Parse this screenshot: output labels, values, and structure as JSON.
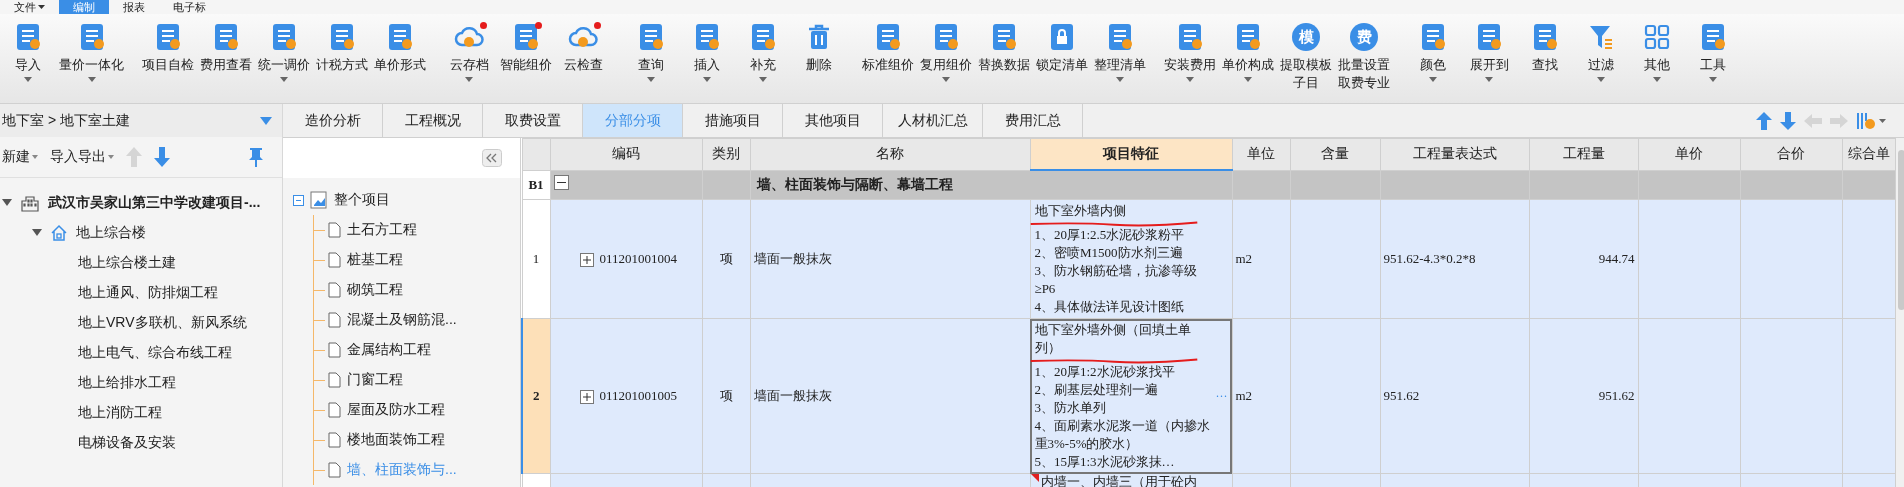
{
  "menu": [
    {
      "label": "文件",
      "dropdown": true,
      "selected": false
    },
    {
      "label": "编制",
      "dropdown": false,
      "selected": true
    },
    {
      "label": "报表",
      "dropdown": false,
      "selected": false
    },
    {
      "label": "电子标",
      "dropdown": false,
      "selected": false
    }
  ],
  "toolbar": {
    "groups": [
      {
        "items": [
          {
            "label": "导入",
            "kind": "icon",
            "dropdown": true,
            "badge": false
          },
          {
            "label": "量价一体化",
            "kind": "icon",
            "dropdown": true,
            "badge": false
          }
        ]
      },
      {
        "items": [
          {
            "label": "项目自检",
            "kind": "icon",
            "dropdown": false,
            "badge": false
          },
          {
            "label": "费用查看",
            "kind": "icon",
            "dropdown": false,
            "badge": false
          },
          {
            "label": "统一调价",
            "kind": "icon",
            "dropdown": true,
            "badge": false
          },
          {
            "label": "计税方式",
            "kind": "icon",
            "dropdown": false,
            "badge": false
          },
          {
            "label": "单价形式",
            "kind": "icon",
            "dropdown": false,
            "badge": false
          }
        ]
      },
      {
        "items": [
          {
            "label": "云存档",
            "kind": "cloud",
            "dropdown": true,
            "badge": true
          },
          {
            "label": "智能组价",
            "kind": "icon",
            "dropdown": false,
            "badge": true
          },
          {
            "label": "云检查",
            "kind": "cloud",
            "dropdown": false,
            "badge": true
          }
        ]
      },
      {
        "items": [
          {
            "label": "查询",
            "kind": "icon",
            "dropdown": true,
            "badge": false
          },
          {
            "label": "插入",
            "kind": "icon",
            "dropdown": true,
            "badge": false
          },
          {
            "label": "补充",
            "kind": "icon",
            "dropdown": true,
            "badge": false
          },
          {
            "label": "删除",
            "kind": "trash",
            "dropdown": false,
            "badge": false
          }
        ]
      },
      {
        "items": [
          {
            "label": "标准组价",
            "kind": "icon",
            "dropdown": false,
            "badge": false
          },
          {
            "label": "复用组价",
            "kind": "icon",
            "dropdown": true,
            "badge": false
          },
          {
            "label": "替换数据",
            "kind": "icon",
            "dropdown": false,
            "badge": false
          },
          {
            "label": "锁定清单",
            "kind": "lock",
            "dropdown": false,
            "badge": false
          },
          {
            "label": "整理清单",
            "kind": "icon",
            "dropdown": true,
            "badge": false
          }
        ]
      },
      {
        "items": [
          {
            "label": "安装费用",
            "kind": "icon",
            "dropdown": true,
            "badge": false
          },
          {
            "label": "单价构成",
            "kind": "icon",
            "dropdown": true,
            "badge": false
          },
          {
            "label": "提取模板",
            "label_2": "子目",
            "kind": "glyph",
            "glyph": "模",
            "dropdown": false,
            "badge": false
          },
          {
            "label": "批量设置",
            "label_2": "取费专业",
            "kind": "glyph",
            "glyph": "费",
            "dropdown": false,
            "badge": false
          }
        ]
      },
      {
        "items": [
          {
            "label": "颜色",
            "kind": "icon",
            "dropdown": true,
            "badge": false
          },
          {
            "label": "展开到",
            "kind": "icon",
            "dropdown": true,
            "badge": false
          },
          {
            "label": "查找",
            "kind": "icon",
            "dropdown": false,
            "badge": false
          },
          {
            "label": "过滤",
            "kind": "filter",
            "dropdown": true,
            "badge": false
          },
          {
            "label": "其他",
            "kind": "grid",
            "dropdown": true,
            "badge": false
          },
          {
            "label": "工具",
            "kind": "icon",
            "dropdown": true,
            "badge": false
          }
        ]
      }
    ]
  },
  "breadcrumb": "地下室 > 地下室土建",
  "project_toolbar": {
    "buttons": [
      {
        "label": "新建",
        "dropdown": true
      },
      {
        "label": "导入导出",
        "dropdown": true
      }
    ],
    "move_up_disabled": true,
    "move_down_disabled": false
  },
  "project_tree": [
    {
      "label": "武汉市吴家山第三中学改建项目-...",
      "expanded": true,
      "children": [
        {
          "label": "地上综合楼",
          "expanded": true,
          "children": [
            {
              "label": "地上综合楼土建"
            },
            {
              "label": "地上通风、防排烟工程"
            },
            {
              "label": "地上VRV多联机、新风系统"
            },
            {
              "label": "地上电气、综合布线工程"
            },
            {
              "label": "地上给排水工程"
            },
            {
              "label": "地上消防工程"
            },
            {
              "label": "电梯设备及安装"
            }
          ]
        }
      ]
    }
  ],
  "section_tree": {
    "label": "整个项目",
    "expanded": true,
    "children": [
      {
        "label": "土石方工程",
        "selected": false
      },
      {
        "label": "桩基工程",
        "selected": false
      },
      {
        "label": "砌筑工程",
        "selected": false
      },
      {
        "label": "混凝土及钢筋混...",
        "selected": false
      },
      {
        "label": "金属结构工程",
        "selected": false
      },
      {
        "label": "门窗工程",
        "selected": false
      },
      {
        "label": "屋面及防水工程",
        "selected": false
      },
      {
        "label": "楼地面装饰工程",
        "selected": false
      },
      {
        "label": "墙、柱面装饰与...",
        "selected": true
      }
    ]
  },
  "tabs": [
    {
      "label": "造价分析",
      "selected": false
    },
    {
      "label": "工程概况",
      "selected": false
    },
    {
      "label": "取费设置",
      "selected": false
    },
    {
      "label": "分部分项",
      "selected": true
    },
    {
      "label": "措施项目",
      "selected": false
    },
    {
      "label": "其他项目",
      "selected": false
    },
    {
      "label": "人材机汇总",
      "selected": false
    },
    {
      "label": "费用汇总",
      "selected": false
    }
  ],
  "table": {
    "columns": [
      {
        "label": "编码",
        "selected": false
      },
      {
        "label": "类别",
        "selected": false
      },
      {
        "label": "名称",
        "selected": false
      },
      {
        "label": "项目特征",
        "selected": true
      },
      {
        "label": "单位",
        "selected": false
      },
      {
        "label": "含量",
        "selected": false
      },
      {
        "label": "工程量表达式",
        "selected": false
      },
      {
        "label": "工程量",
        "selected": false
      },
      {
        "label": "单价",
        "selected": false
      },
      {
        "label": "合价",
        "selected": false
      },
      {
        "label": "综合单",
        "selected": false
      }
    ],
    "section": {
      "index": "B1",
      "expanded": true,
      "name": "墙、柱面装饰与隔断、幕墙工程"
    },
    "rows": [
      {
        "index": "1",
        "code": "011201001004",
        "type": "项",
        "name": "墙面一般抹灰",
        "features": [
          "地下室外墙内侧",
          "1、20厚1:2.5水泥砂浆粉平",
          "2、密喷M1500防水剂三遍",
          "3、防水钢筋砼墙，抗渗等级≥P6",
          "4、具体做法详见设计图纸"
        ],
        "unit": "m2",
        "expression": "951.62-4.3*0.2*8",
        "quantity": "944.74",
        "expanded": false,
        "selected": false,
        "marked": true,
        "flagged": false
      },
      {
        "index": "2",
        "code": "011201001005",
        "type": "项",
        "name": "墙面一般抹灰",
        "features": [
          "地下室外墙外侧（回填土单列）",
          "1、20厚1:2水泥砂浆找平",
          "2、刷基层处理剂一遍",
          "3、防水单列",
          "4、面刷素水泥浆一道（内掺水重3%-5%的胶水）",
          "5、15厚1:3水泥砂浆抹…"
        ],
        "unit": "m2",
        "expression": "951.62",
        "quantity": "951.62",
        "more": "···",
        "expanded": false,
        "selected": true,
        "marked": true,
        "flagged": false
      },
      {
        "features": [
          "内墙一、内墙三（用于砼内"
        ],
        "selected": false,
        "marked": false,
        "flagged": true
      }
    ]
  }
}
